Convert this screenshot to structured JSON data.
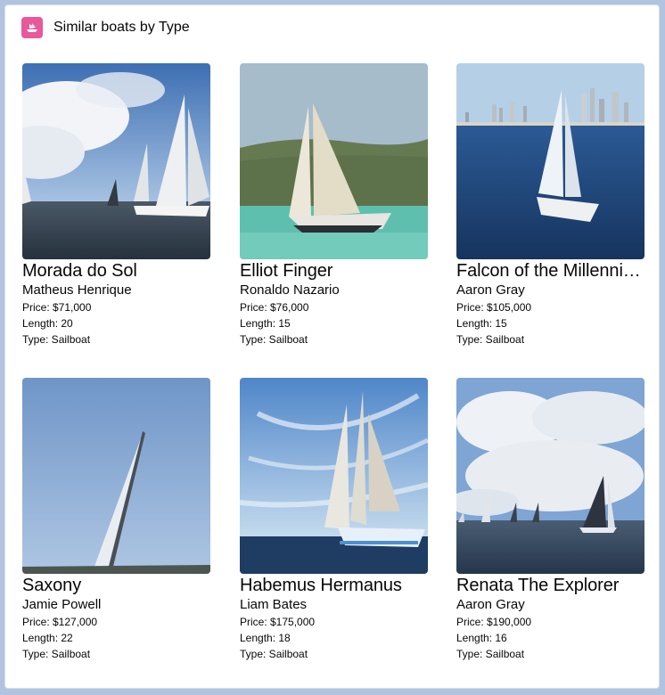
{
  "header": {
    "title": "Similar boats by Type",
    "icon": "boat-icon",
    "icon_color": "#e8599b"
  },
  "boats": [
    {
      "name": "Morada do Sol",
      "owner": "Matheus Henrique",
      "price": "Price: $71,000",
      "length": "Length: 20",
      "type": "Type: Sailboat"
    },
    {
      "name": "Elliot Finger",
      "owner": "Ronaldo Nazario",
      "price": "Price: $76,000",
      "length": "Length: 15",
      "type": "Type: Sailboat"
    },
    {
      "name": "Falcon of the Millennium",
      "owner": "Aaron Gray",
      "price": "Price: $105,000",
      "length": "Length: 15",
      "type": "Type: Sailboat"
    },
    {
      "name": "Saxony",
      "owner": "Jamie Powell",
      "price": "Price: $127,000",
      "length": "Length: 22",
      "type": "Type: Sailboat"
    },
    {
      "name": "Habemus Hermanus",
      "owner": "Liam Bates",
      "price": "Price: $175,000",
      "length": "Length: 18",
      "type": "Type: Sailboat"
    },
    {
      "name": "Renata The Explorer",
      "owner": "Aaron Gray",
      "price": "Price: $190,000",
      "length": "Length: 16",
      "type": "Type: Sailboat"
    }
  ]
}
